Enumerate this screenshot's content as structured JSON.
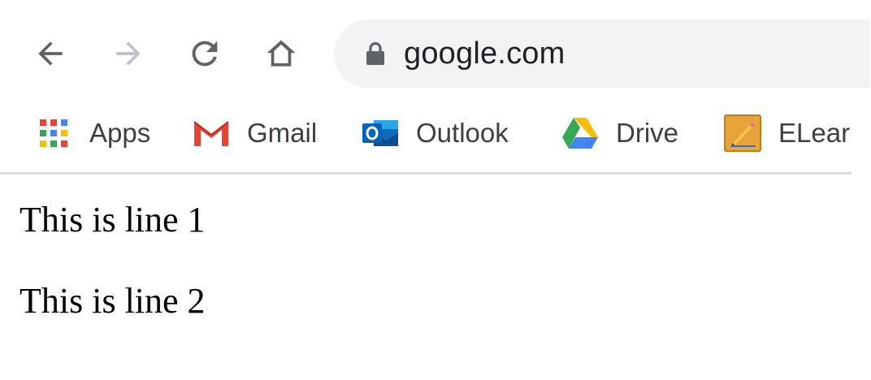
{
  "toolbar": {
    "back_icon": "arrow-left-icon",
    "forward_icon": "arrow-right-icon",
    "reload_icon": "reload-icon",
    "home_icon": "home-icon"
  },
  "omnibox": {
    "lock_icon": "lock-icon",
    "url": "google.com"
  },
  "bookmarks": [
    {
      "label": "Apps",
      "icon": "apps-grid-icon"
    },
    {
      "label": "Gmail",
      "icon": "gmail-icon"
    },
    {
      "label": "Outlook",
      "icon": "outlook-icon"
    },
    {
      "label": "Drive",
      "icon": "drive-icon"
    },
    {
      "label": "ELear",
      "icon": "pencil-icon"
    }
  ],
  "page": {
    "lines": [
      "This is line 1",
      "This is line 2"
    ]
  },
  "colors": {
    "omnibox_bg": "#f1f3f4",
    "icon_gray": "#5f6368",
    "icon_disabled": "#bdc1c6",
    "divider": "#dadce0"
  }
}
